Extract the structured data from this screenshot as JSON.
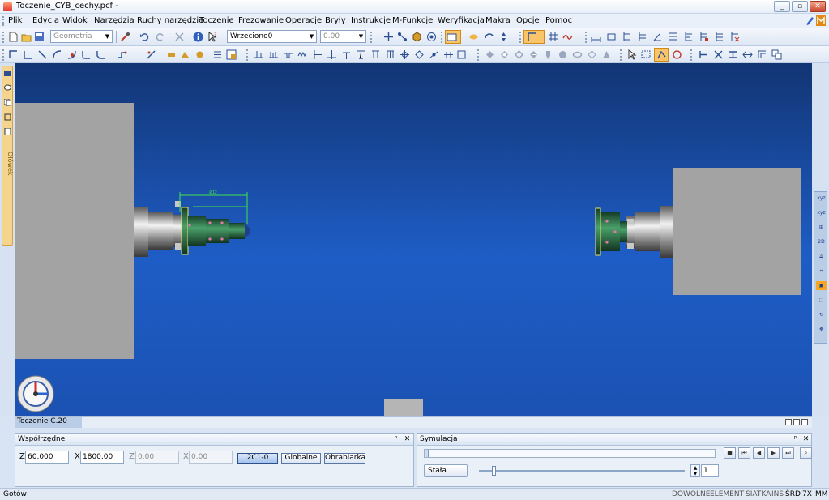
{
  "window": {
    "title": "Toczenie_CYB_cechy.pcf -",
    "minimize": "_",
    "maximize": "▫",
    "close": "✕"
  },
  "menu": {
    "items": [
      "Plik",
      "Edycja",
      "Widok",
      "Narzędzia",
      "Ruchy narzędzie",
      "Toczenie",
      "Frezowanie",
      "Operacje",
      "Bryły",
      "Instrukcje",
      "M-Funkcje",
      "Weryfikacja",
      "Makra",
      "Opcje",
      "Pomoc"
    ]
  },
  "toolbar": {
    "geometry_combo": {
      "value": "Geometria"
    },
    "spindle_combo": {
      "value": "Wrzeciono0"
    },
    "value_combo": {
      "value": "0.00"
    }
  },
  "sidebar": {
    "tab_label": "Ołówek"
  },
  "viewport": {
    "tab_label": "Toczenie C.20",
    "dim_label": "Ø12"
  },
  "coords_panel": {
    "title": "Współrzędne",
    "z_label": "Z",
    "z_value": "60.000",
    "x_label": "X",
    "x_value": "1800.00",
    "z2_label": "Z",
    "z2_value": "0.00",
    "x2_label": "X",
    "x2_value": "0.00",
    "buttons": [
      "2C1-0",
      "Globalne",
      "Obrabiarka"
    ],
    "pin": "ᵖ",
    "close": "✕"
  },
  "sim_panel": {
    "title": "Symulacja",
    "mode_label": "Stała",
    "step_value": "1",
    "pin": "ᵖ",
    "close": "✕"
  },
  "statusbar": {
    "text": "Gotów",
    "indicators": [
      "DOWOLNE",
      "ELEMENT",
      "SIATKA",
      "INS",
      "ŚRD",
      "7X",
      "MM"
    ]
  },
  "colors": {
    "viewport_top": "#123574",
    "viewport_bottom": "#1b52b3",
    "chuck_gray": "#9e9e9e",
    "part_green": "#2e7d4c",
    "accent_orange": "#f5a623"
  }
}
